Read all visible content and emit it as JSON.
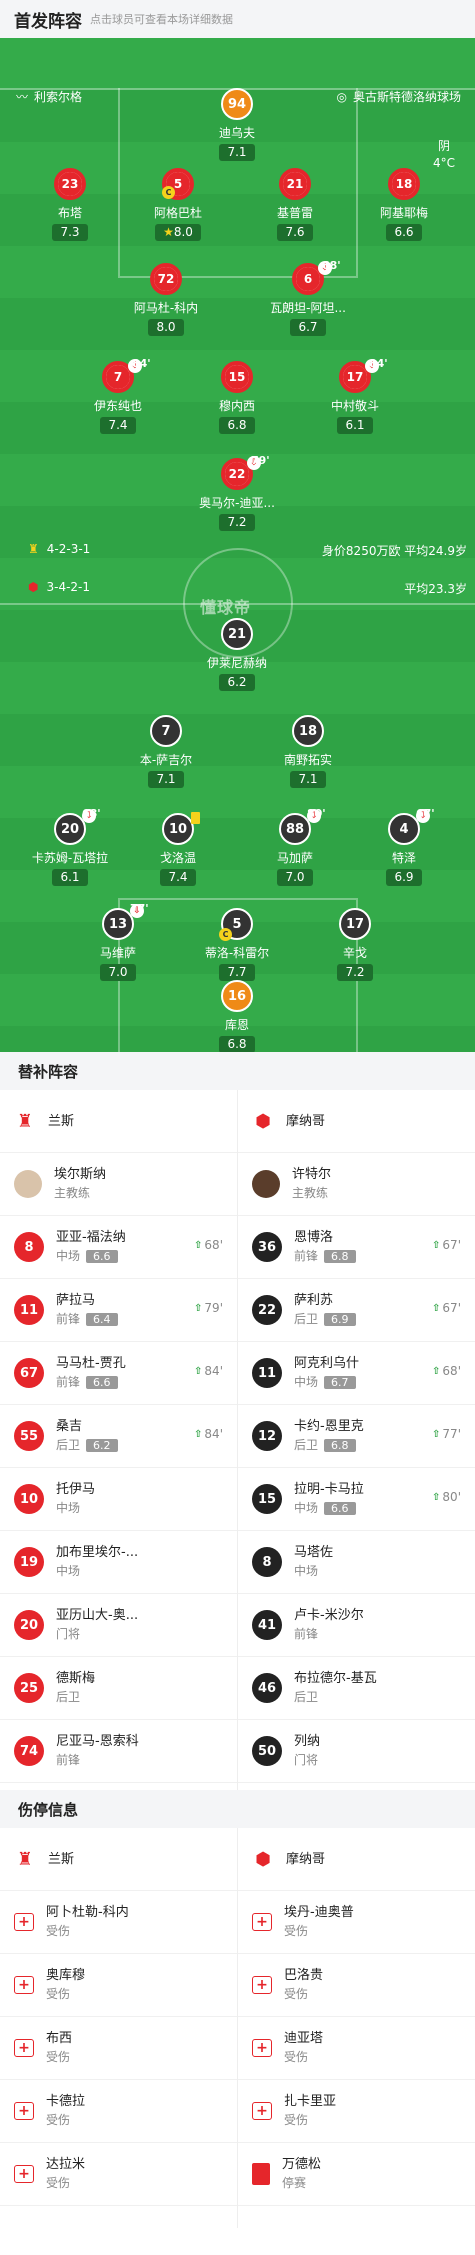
{
  "header": {
    "title": "首发阵容",
    "subtitle": "点击球员可查看本场详细数据"
  },
  "venue": {
    "home": "利索尔格",
    "away": "奥古斯特德洛纳球场"
  },
  "weather": {
    "cond": "阴",
    "temp": "4°C"
  },
  "brand": "懂球帝",
  "home_form": {
    "formation": "4-2-3-1",
    "info": "身价8250万欧 平均24.9岁"
  },
  "away_form": {
    "formation": "3-4-2-1",
    "info": "平均23.3岁"
  },
  "home_players": [
    {
      "num": "94",
      "name": "迪乌夫",
      "rating": "7.1"
    },
    {
      "num": "23",
      "name": "布塔",
      "rating": "7.3"
    },
    {
      "num": "5",
      "name": "阿格巴杜",
      "rating": "8.0"
    },
    {
      "num": "21",
      "name": "基普雷",
      "rating": "7.6"
    },
    {
      "num": "18",
      "name": "阿基耶梅",
      "rating": "6.6"
    },
    {
      "num": "72",
      "name": "阿马杜-科内",
      "rating": "8.0"
    },
    {
      "num": "6",
      "name": "瓦朗坦-阿坦...",
      "rating": "6.7",
      "sub": "68'"
    },
    {
      "num": "7",
      "name": "伊东纯也",
      "rating": "7.4",
      "sub": "84'"
    },
    {
      "num": "15",
      "name": "穆内西",
      "rating": "6.8"
    },
    {
      "num": "17",
      "name": "中村敬斗",
      "rating": "6.1",
      "sub": "84'"
    },
    {
      "num": "22",
      "name": "奥马尔-迪亚...",
      "rating": "7.2",
      "sub": "79'"
    }
  ],
  "away_players": [
    {
      "num": "21",
      "name": "伊莱尼赫纳",
      "rating": "6.2",
      "sub": "67'"
    },
    {
      "num": "7",
      "name": "本-萨吉尔",
      "rating": "7.1"
    },
    {
      "num": "18",
      "name": "南野拓实",
      "rating": "7.1"
    },
    {
      "num": "20",
      "name": "卡苏姆-瓦塔拉",
      "rating": "6.1",
      "sub": "68'"
    },
    {
      "num": "10",
      "name": "戈洛温",
      "rating": "7.4"
    },
    {
      "num": "88",
      "name": "马加萨",
      "rating": "7.0",
      "sub": "80'"
    },
    {
      "num": "4",
      "name": "特泽",
      "rating": "6.9",
      "sub": "67'"
    },
    {
      "num": "13",
      "name": "马维萨",
      "rating": "7.0",
      "sub": "77'"
    },
    {
      "num": "5",
      "name": "蒂洛-科雷尔",
      "rating": "7.7"
    },
    {
      "num": "17",
      "name": "辛戈",
      "rating": "7.2"
    },
    {
      "num": "16",
      "name": "库恩",
      "rating": "6.8"
    }
  ],
  "subs": {
    "title": "替补阵容",
    "home_team": "兰斯",
    "away_team": "摩纳哥",
    "home_coach": {
      "name": "埃尔斯纳",
      "role": "主教练"
    },
    "away_coach": {
      "name": "许特尔",
      "role": "主教练"
    },
    "home": [
      {
        "num": "8",
        "name": "亚亚-福法纳",
        "pos": "中场",
        "rating": "6.6",
        "time": "68'"
      },
      {
        "num": "11",
        "name": "萨拉马",
        "pos": "前锋",
        "rating": "6.4",
        "time": "79'"
      },
      {
        "num": "67",
        "name": "马马杜-贾孔",
        "pos": "前锋",
        "rating": "6.6",
        "time": "84'"
      },
      {
        "num": "55",
        "name": "桑吉",
        "pos": "后卫",
        "rating": "6.2",
        "time": "84'"
      },
      {
        "num": "10",
        "name": "托伊马",
        "pos": "中场",
        "rating": "",
        "time": ""
      },
      {
        "num": "19",
        "name": "加布里埃尔-...",
        "pos": "中场",
        "rating": "",
        "time": ""
      },
      {
        "num": "20",
        "name": "亚历山大-奥...",
        "pos": "门将",
        "rating": "",
        "time": ""
      },
      {
        "num": "25",
        "name": "德斯梅",
        "pos": "后卫",
        "rating": "",
        "time": ""
      },
      {
        "num": "74",
        "name": "尼亚马-恩索科",
        "pos": "前锋",
        "rating": "",
        "time": ""
      }
    ],
    "away": [
      {
        "num": "36",
        "name": "恩博洛",
        "pos": "前锋",
        "rating": "6.8",
        "time": "67'"
      },
      {
        "num": "22",
        "name": "萨利苏",
        "pos": "后卫",
        "rating": "6.9",
        "time": "67'"
      },
      {
        "num": "11",
        "name": "阿克利乌什",
        "pos": "中场",
        "rating": "6.7",
        "time": "68'"
      },
      {
        "num": "12",
        "name": "卡约-恩里克",
        "pos": "后卫",
        "rating": "6.8",
        "time": "77'"
      },
      {
        "num": "15",
        "name": "拉明-卡马拉",
        "pos": "中场",
        "rating": "6.6",
        "time": "80'"
      },
      {
        "num": "8",
        "name": "马塔佐",
        "pos": "中场",
        "rating": "",
        "time": ""
      },
      {
        "num": "41",
        "name": "卢卡-米沙尔",
        "pos": "前锋",
        "rating": "",
        "time": ""
      },
      {
        "num": "46",
        "name": "布拉德尔-基瓦",
        "pos": "后卫",
        "rating": "",
        "time": ""
      },
      {
        "num": "50",
        "name": "列纳",
        "pos": "门将",
        "rating": "",
        "time": ""
      }
    ]
  },
  "injuries": {
    "title": "伤停信息",
    "home_team": "兰斯",
    "away_team": "摩纳哥",
    "home": [
      {
        "name": "阿卜杜勒-科内",
        "status": "受伤"
      },
      {
        "name": "奥库穆",
        "status": "受伤"
      },
      {
        "name": "布西",
        "status": "受伤"
      },
      {
        "name": "卡德拉",
        "status": "受伤"
      },
      {
        "name": "达拉米",
        "status": "受伤"
      }
    ],
    "away": [
      {
        "name": "埃丹-迪奥普",
        "status": "受伤"
      },
      {
        "name": "巴洛贵",
        "status": "受伤"
      },
      {
        "name": "迪亚塔",
        "status": "受伤"
      },
      {
        "name": "扎卡里亚",
        "status": "受伤"
      },
      {
        "name": "万德松",
        "status": "停赛"
      }
    ]
  },
  "colors": {
    "pitch": "#2fa345",
    "home": "#e5262b",
    "away": "#222222",
    "gk": "#ef8a17"
  }
}
